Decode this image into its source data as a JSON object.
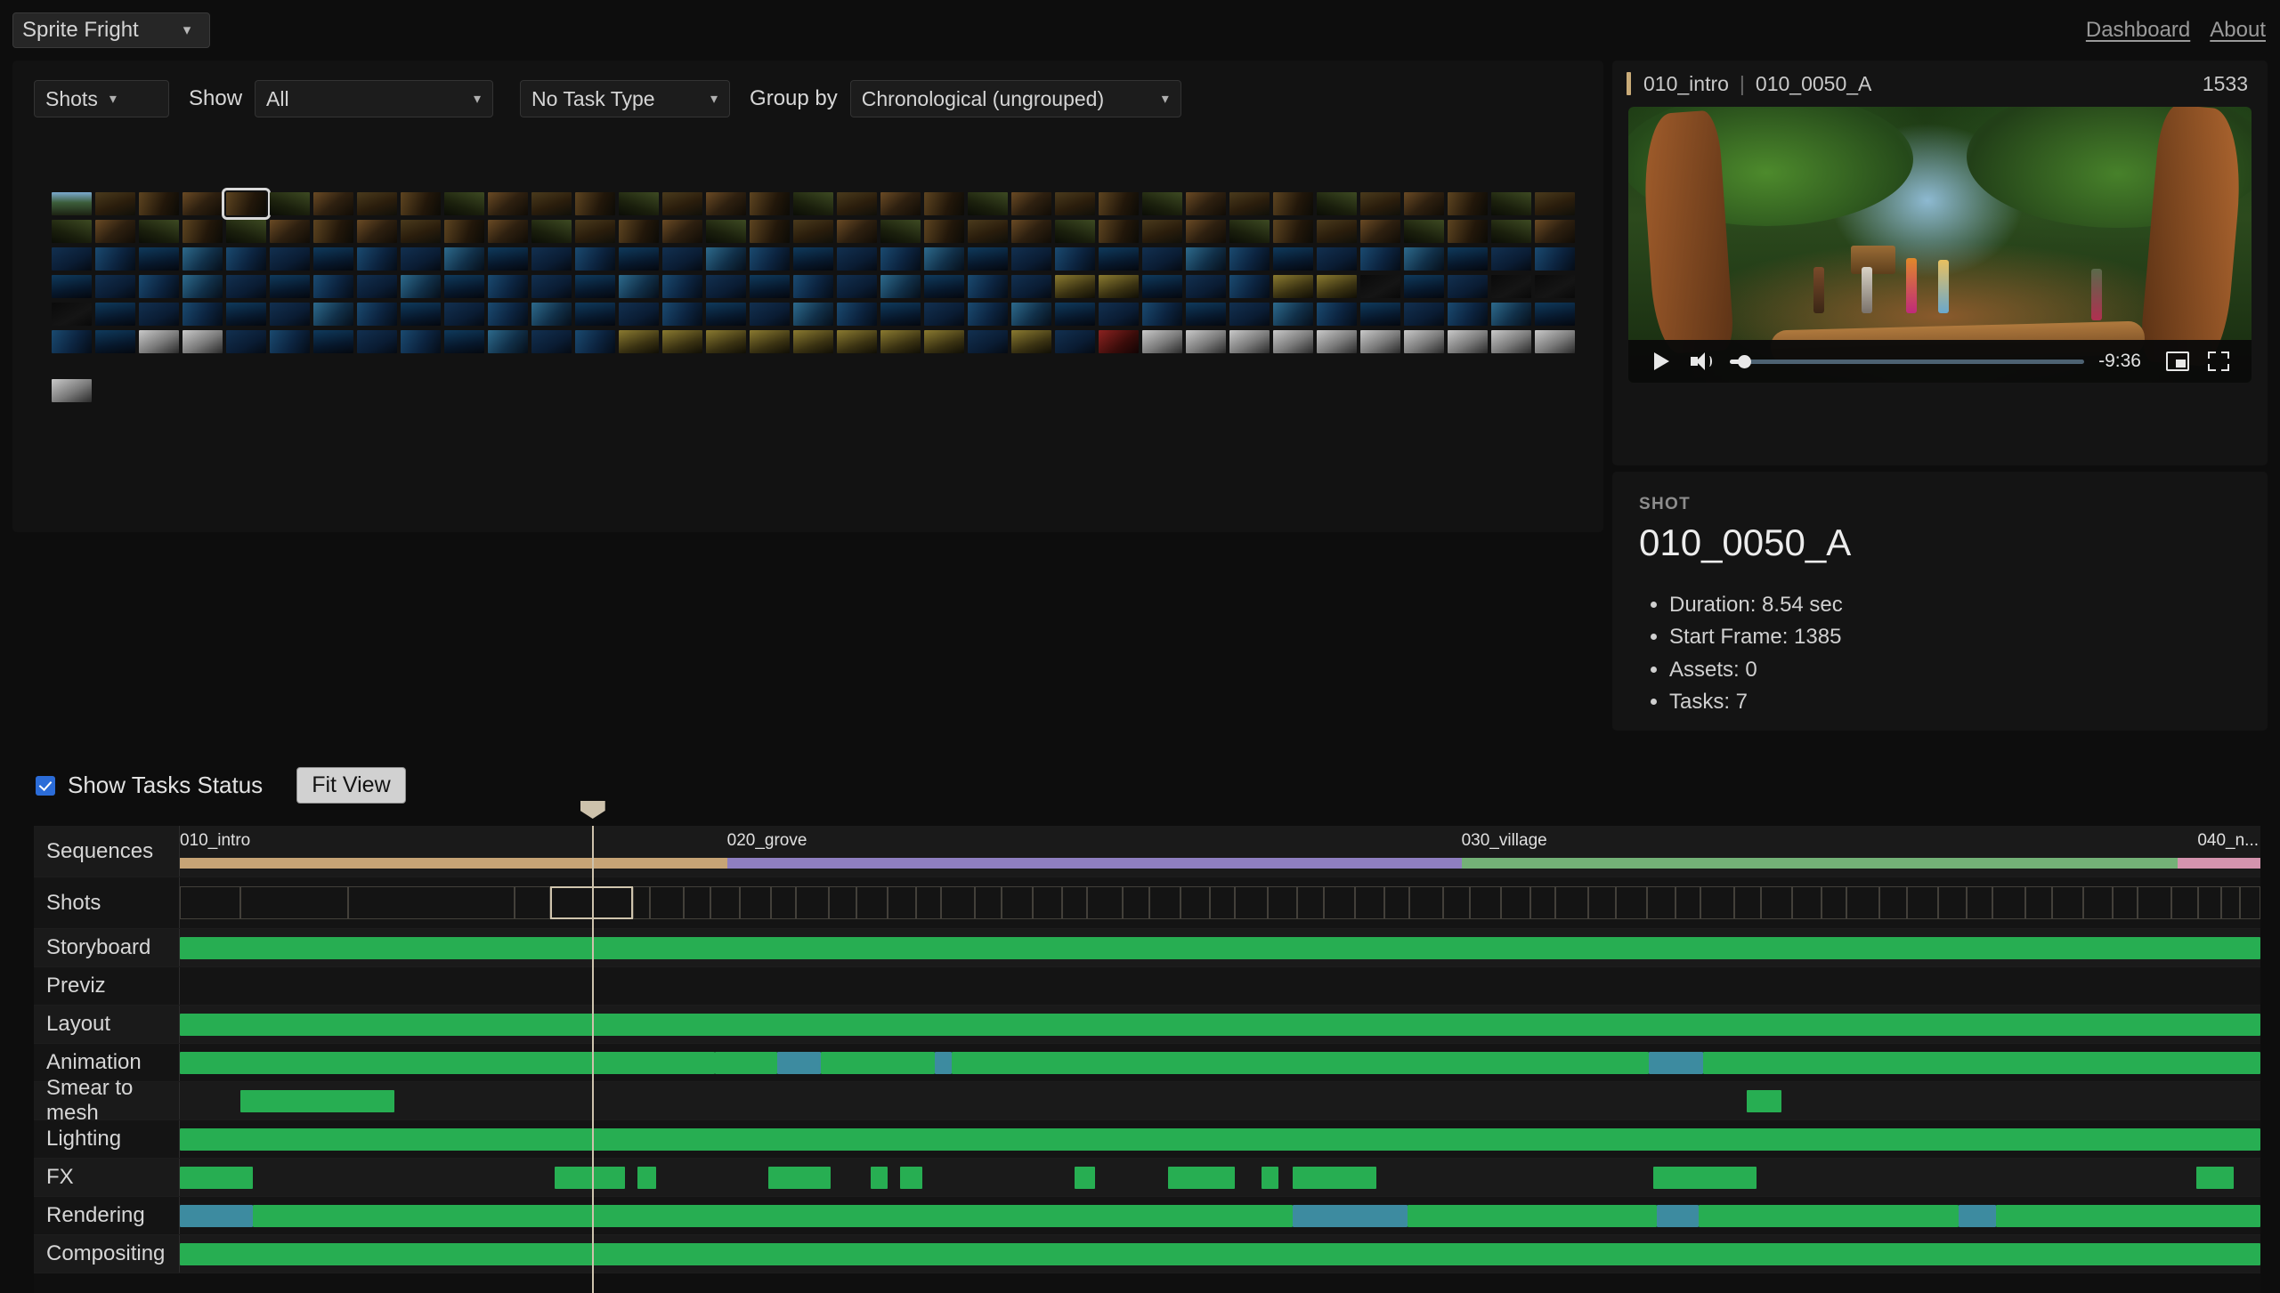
{
  "topbar": {
    "project": "Sprite Fright",
    "chevron": "chevron-down-icon",
    "nav": [
      {
        "label": "Dashboard"
      },
      {
        "label": "About"
      }
    ]
  },
  "filters": {
    "entity_type": "Shots",
    "show_label": "Show",
    "show_value": "All",
    "task_type": "No Task Type",
    "group_by_label": "Group by",
    "group_by_value": "Chronological (ungrouped)"
  },
  "thumbnail_grid": {
    "selected_index": 4,
    "rows": 6,
    "per_row": 35,
    "total": 176,
    "palettes": [
      "tA",
      "tB",
      "tC",
      "tD",
      "tE",
      "tD",
      "tC",
      "tB",
      "tA",
      "tD",
      "tB",
      "tC",
      "tA",
      "tD",
      "tB",
      "tC",
      "tA",
      "tB",
      "tD",
      "tC",
      "tA",
      "tB",
      "tD",
      "tC",
      "tA",
      "tB",
      "tD",
      "tC",
      "tA",
      "tB",
      "tD",
      "tC",
      "tA",
      "tB",
      "tD"
    ]
  },
  "preview": {
    "sequence": "010_intro",
    "separator": "|",
    "shot": "010_0050_A",
    "frame": "1533",
    "player": {
      "play_icon": "play-icon",
      "volume_icon": "volume-icon",
      "time_remaining": "-9:36",
      "pip_icon": "picture-in-picture-icon",
      "fullscreen_icon": "fullscreen-icon",
      "progress_percent": 4
    }
  },
  "shot_detail": {
    "kicker": "SHOT",
    "name": "010_0050_A",
    "facts": [
      "Duration: 8.54 sec",
      "Start Frame: 1385",
      "Assets: 0",
      "Tasks: 7"
    ]
  },
  "timeline_controls": {
    "show_tasks_status_label": "Show Tasks Status",
    "show_tasks_status_checked": true,
    "fit_view_label": "Fit View"
  },
  "timeline": {
    "playhead_percent": 19.8,
    "sequences": [
      {
        "label": "010_intro",
        "start_pct": 0.0,
        "width_pct": 26.3,
        "color": "#c7a476"
      },
      {
        "label": "020_grove",
        "start_pct": 26.3,
        "width_pct": 35.3,
        "color": "#8f7fc0"
      },
      {
        "label": "030_village",
        "start_pct": 61.6,
        "width_pct": 34.4,
        "color": "#74b177"
      },
      {
        "label": "040_n...",
        "start_pct": 96.0,
        "width_pct": 4.0,
        "color": "#d494ae"
      }
    ],
    "shots_row_label": "Shots",
    "sequences_row_label": "Sequences",
    "active_shot_index": 4,
    "shots": [
      {
        "start_pct": 0.0,
        "width_pct": 2.9
      },
      {
        "start_pct": 2.9,
        "width_pct": 5.2
      },
      {
        "start_pct": 8.1,
        "width_pct": 8.0
      },
      {
        "start_pct": 16.1,
        "width_pct": 1.7
      },
      {
        "start_pct": 17.8,
        "width_pct": 4.0
      },
      {
        "start_pct": 21.8,
        "width_pct": 0.8
      },
      {
        "start_pct": 22.6,
        "width_pct": 1.6
      },
      {
        "start_pct": 24.2,
        "width_pct": 1.3
      },
      {
        "start_pct": 25.5,
        "width_pct": 1.4
      },
      {
        "start_pct": 26.9,
        "width_pct": 1.5
      },
      {
        "start_pct": 28.4,
        "width_pct": 1.2
      },
      {
        "start_pct": 29.6,
        "width_pct": 1.6
      },
      {
        "start_pct": 31.2,
        "width_pct": 1.3
      },
      {
        "start_pct": 32.5,
        "width_pct": 1.5
      },
      {
        "start_pct": 34.0,
        "width_pct": 1.4
      },
      {
        "start_pct": 35.4,
        "width_pct": 1.2
      },
      {
        "start_pct": 36.6,
        "width_pct": 1.6
      },
      {
        "start_pct": 38.2,
        "width_pct": 1.3
      },
      {
        "start_pct": 39.5,
        "width_pct": 1.5
      },
      {
        "start_pct": 41.0,
        "width_pct": 1.4
      },
      {
        "start_pct": 42.4,
        "width_pct": 1.2
      },
      {
        "start_pct": 43.6,
        "width_pct": 1.7
      },
      {
        "start_pct": 45.3,
        "width_pct": 1.3
      },
      {
        "start_pct": 46.6,
        "width_pct": 1.5
      },
      {
        "start_pct": 48.1,
        "width_pct": 1.4
      },
      {
        "start_pct": 49.5,
        "width_pct": 1.2
      },
      {
        "start_pct": 50.7,
        "width_pct": 1.6
      },
      {
        "start_pct": 52.3,
        "width_pct": 1.4
      },
      {
        "start_pct": 53.7,
        "width_pct": 1.3
      },
      {
        "start_pct": 55.0,
        "width_pct": 1.5
      },
      {
        "start_pct": 56.5,
        "width_pct": 1.4
      },
      {
        "start_pct": 57.9,
        "width_pct": 1.2
      },
      {
        "start_pct": 59.1,
        "width_pct": 1.6
      },
      {
        "start_pct": 60.7,
        "width_pct": 1.3
      },
      {
        "start_pct": 62.0,
        "width_pct": 1.5
      },
      {
        "start_pct": 63.5,
        "width_pct": 1.4
      },
      {
        "start_pct": 64.9,
        "width_pct": 1.2
      },
      {
        "start_pct": 66.1,
        "width_pct": 1.6
      },
      {
        "start_pct": 67.7,
        "width_pct": 1.3
      },
      {
        "start_pct": 69.0,
        "width_pct": 1.5
      },
      {
        "start_pct": 70.5,
        "width_pct": 1.4
      },
      {
        "start_pct": 71.9,
        "width_pct": 1.2
      },
      {
        "start_pct": 73.1,
        "width_pct": 1.6
      },
      {
        "start_pct": 74.7,
        "width_pct": 1.3
      },
      {
        "start_pct": 76.0,
        "width_pct": 1.5
      },
      {
        "start_pct": 77.5,
        "width_pct": 1.4
      },
      {
        "start_pct": 78.9,
        "width_pct": 1.2
      },
      {
        "start_pct": 80.1,
        "width_pct": 1.6
      },
      {
        "start_pct": 81.7,
        "width_pct": 1.3
      },
      {
        "start_pct": 83.0,
        "width_pct": 1.5
      },
      {
        "start_pct": 84.5,
        "width_pct": 1.4
      },
      {
        "start_pct": 85.9,
        "width_pct": 1.2
      },
      {
        "start_pct": 87.1,
        "width_pct": 1.6
      },
      {
        "start_pct": 88.7,
        "width_pct": 1.3
      },
      {
        "start_pct": 90.0,
        "width_pct": 1.5
      },
      {
        "start_pct": 91.5,
        "width_pct": 1.4
      },
      {
        "start_pct": 92.9,
        "width_pct": 1.2
      },
      {
        "start_pct": 94.1,
        "width_pct": 1.6
      },
      {
        "start_pct": 95.7,
        "width_pct": 1.3
      },
      {
        "start_pct": 97.0,
        "width_pct": 1.1
      },
      {
        "start_pct": 98.1,
        "width_pct": 0.9
      },
      {
        "start_pct": 99.0,
        "width_pct": 1.0
      }
    ],
    "task_rows": [
      {
        "label": "Storyboard",
        "bars": [
          {
            "start_pct": 0.0,
            "width_pct": 100.0,
            "color": "#27ae52"
          }
        ]
      },
      {
        "label": "Previz",
        "bars": []
      },
      {
        "label": "Layout",
        "bars": [
          {
            "start_pct": 0.0,
            "width_pct": 100.0,
            "color": "#27ae52"
          }
        ]
      },
      {
        "label": "Animation",
        "bars": [
          {
            "start_pct": 0.0,
            "width_pct": 25.7,
            "color": "#27ae52"
          },
          {
            "start_pct": 25.7,
            "width_pct": 3.0,
            "color": "#27ae52"
          },
          {
            "start_pct": 28.7,
            "width_pct": 2.1,
            "color": "#3d8ba0"
          },
          {
            "start_pct": 30.8,
            "width_pct": 5.5,
            "color": "#27ae52"
          },
          {
            "start_pct": 36.3,
            "width_pct": 0.8,
            "color": "#3d8ba0"
          },
          {
            "start_pct": 37.1,
            "width_pct": 33.5,
            "color": "#27ae52"
          },
          {
            "start_pct": 70.6,
            "width_pct": 2.6,
            "color": "#3d8ba0"
          },
          {
            "start_pct": 73.2,
            "width_pct": 26.8,
            "color": "#27ae52"
          }
        ]
      },
      {
        "label": "Smear to mesh",
        "bars": [
          {
            "start_pct": 2.9,
            "width_pct": 7.4,
            "color": "#27ae52"
          },
          {
            "start_pct": 75.3,
            "width_pct": 1.7,
            "color": "#27ae52"
          }
        ]
      },
      {
        "label": "Lighting",
        "bars": [
          {
            "start_pct": 0.0,
            "width_pct": 100.0,
            "color": "#27ae52"
          }
        ]
      },
      {
        "label": "FX",
        "bars": [
          {
            "start_pct": 0.0,
            "width_pct": 3.5,
            "color": "#27ae52"
          },
          {
            "start_pct": 18.0,
            "width_pct": 3.4,
            "color": "#27ae52"
          },
          {
            "start_pct": 22.0,
            "width_pct": 0.9,
            "color": "#27ae52"
          },
          {
            "start_pct": 28.3,
            "width_pct": 3.0,
            "color": "#27ae52"
          },
          {
            "start_pct": 33.2,
            "width_pct": 0.8,
            "color": "#27ae52"
          },
          {
            "start_pct": 34.6,
            "width_pct": 1.1,
            "color": "#27ae52"
          },
          {
            "start_pct": 43.0,
            "width_pct": 1.0,
            "color": "#27ae52"
          },
          {
            "start_pct": 47.5,
            "width_pct": 3.2,
            "color": "#27ae52"
          },
          {
            "start_pct": 52.0,
            "width_pct": 0.8,
            "color": "#27ae52"
          },
          {
            "start_pct": 53.5,
            "width_pct": 4.0,
            "color": "#27ae52"
          },
          {
            "start_pct": 70.8,
            "width_pct": 5.0,
            "color": "#27ae52"
          },
          {
            "start_pct": 96.9,
            "width_pct": 1.8,
            "color": "#27ae52"
          }
        ]
      },
      {
        "label": "Rendering",
        "bars": [
          {
            "start_pct": 0.0,
            "width_pct": 3.5,
            "color": "#3d8ba0"
          },
          {
            "start_pct": 3.5,
            "width_pct": 50.0,
            "color": "#27ae52"
          },
          {
            "start_pct": 53.5,
            "width_pct": 5.5,
            "color": "#3d8ba0"
          },
          {
            "start_pct": 59.0,
            "width_pct": 12.0,
            "color": "#27ae52"
          },
          {
            "start_pct": 71.0,
            "width_pct": 2.0,
            "color": "#3d8ba0"
          },
          {
            "start_pct": 73.0,
            "width_pct": 12.5,
            "color": "#27ae52"
          },
          {
            "start_pct": 85.5,
            "width_pct": 1.8,
            "color": "#3d8ba0"
          },
          {
            "start_pct": 87.3,
            "width_pct": 12.7,
            "color": "#27ae52"
          }
        ]
      },
      {
        "label": "Compositing",
        "bars": [
          {
            "start_pct": 0.0,
            "width_pct": 100.0,
            "color": "#27ae52"
          }
        ]
      }
    ]
  }
}
